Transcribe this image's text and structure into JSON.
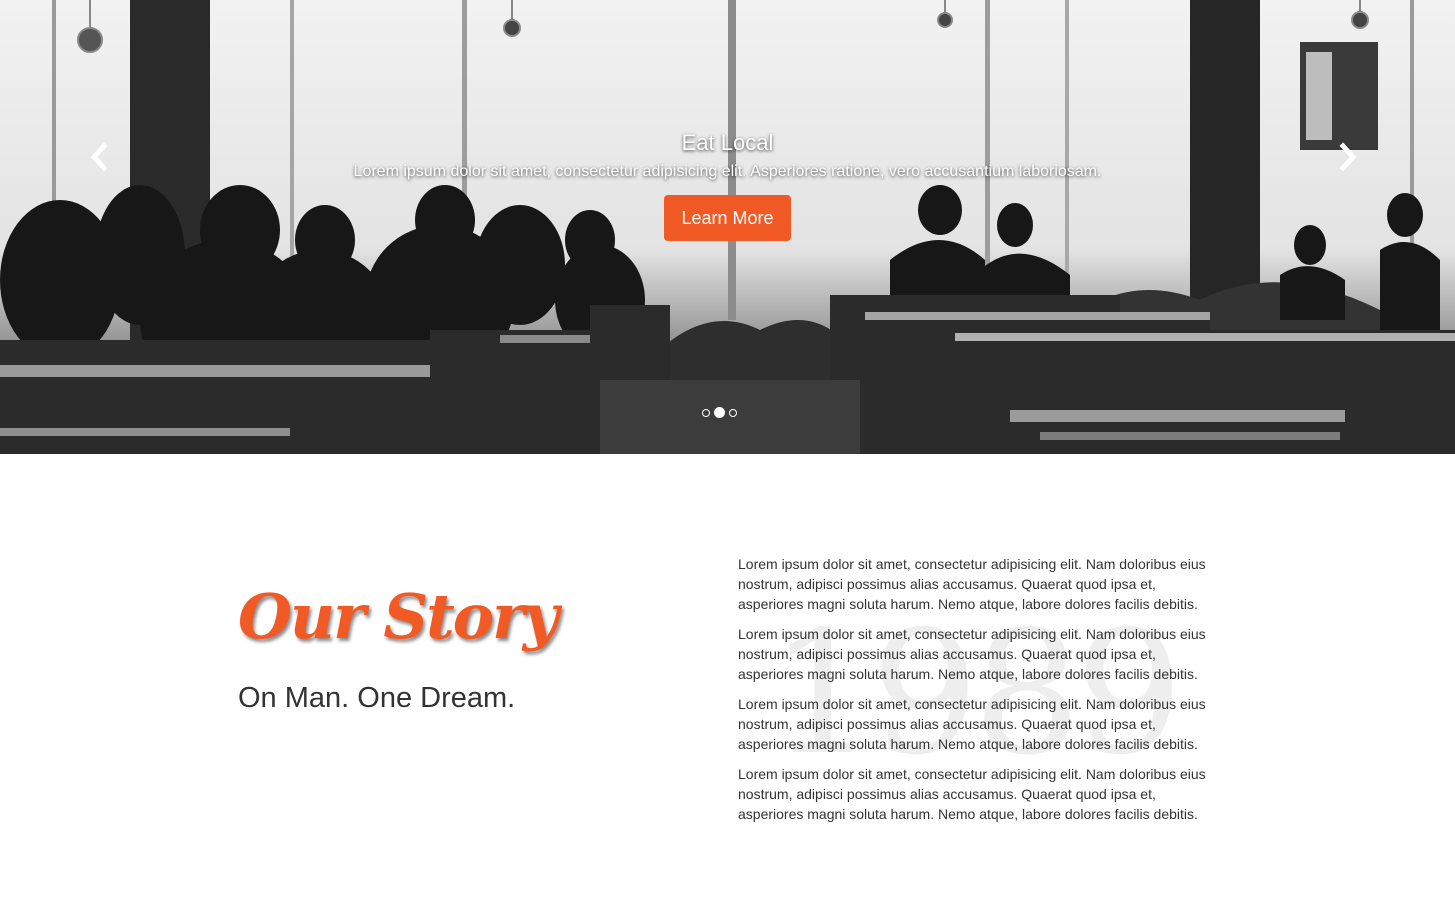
{
  "carousel": {
    "slide_title": "Eat Local",
    "slide_text": "Lorem ipsum dolor sit amet, consectetur adipisicing elit. Asperiores ratione, vero accusantium laboriosam.",
    "button_label": "Learn More",
    "accent_color": "#f15a24",
    "slide_count": 3,
    "active_slide": 2
  },
  "story": {
    "heading": "Our Story",
    "subheading": "On Man. One Dream.",
    "watermark": "1989",
    "paragraphs": [
      "Lorem ipsum dolor sit amet, consectetur adipisicing elit. Nam doloribus eius nostrum, adipisci possimus alias accusamus. Quaerat quod ipsa et, asperiores magni soluta harum. Nemo atque, labore dolores facilis debitis.",
      "Lorem ipsum dolor sit amet, consectetur adipisicing elit. Nam doloribus eius nostrum, adipisci possimus alias accusamus. Quaerat quod ipsa et, asperiores magni soluta harum. Nemo atque, labore dolores facilis debitis.",
      "Lorem ipsum dolor sit amet, consectetur adipisicing elit. Nam doloribus eius nostrum, adipisci possimus alias accusamus. Quaerat quod ipsa et, asperiores magni soluta harum. Nemo atque, labore dolores facilis debitis.",
      "Lorem ipsum dolor sit amet, consectetur adipisicing elit. Nam doloribus eius nostrum, adipisci possimus alias accusamus. Quaerat quod ipsa et, asperiores magni soluta harum. Nemo atque, labore dolores facilis debitis."
    ]
  },
  "icons": {
    "prev": "chevron-left-icon",
    "next": "chevron-right-icon"
  }
}
